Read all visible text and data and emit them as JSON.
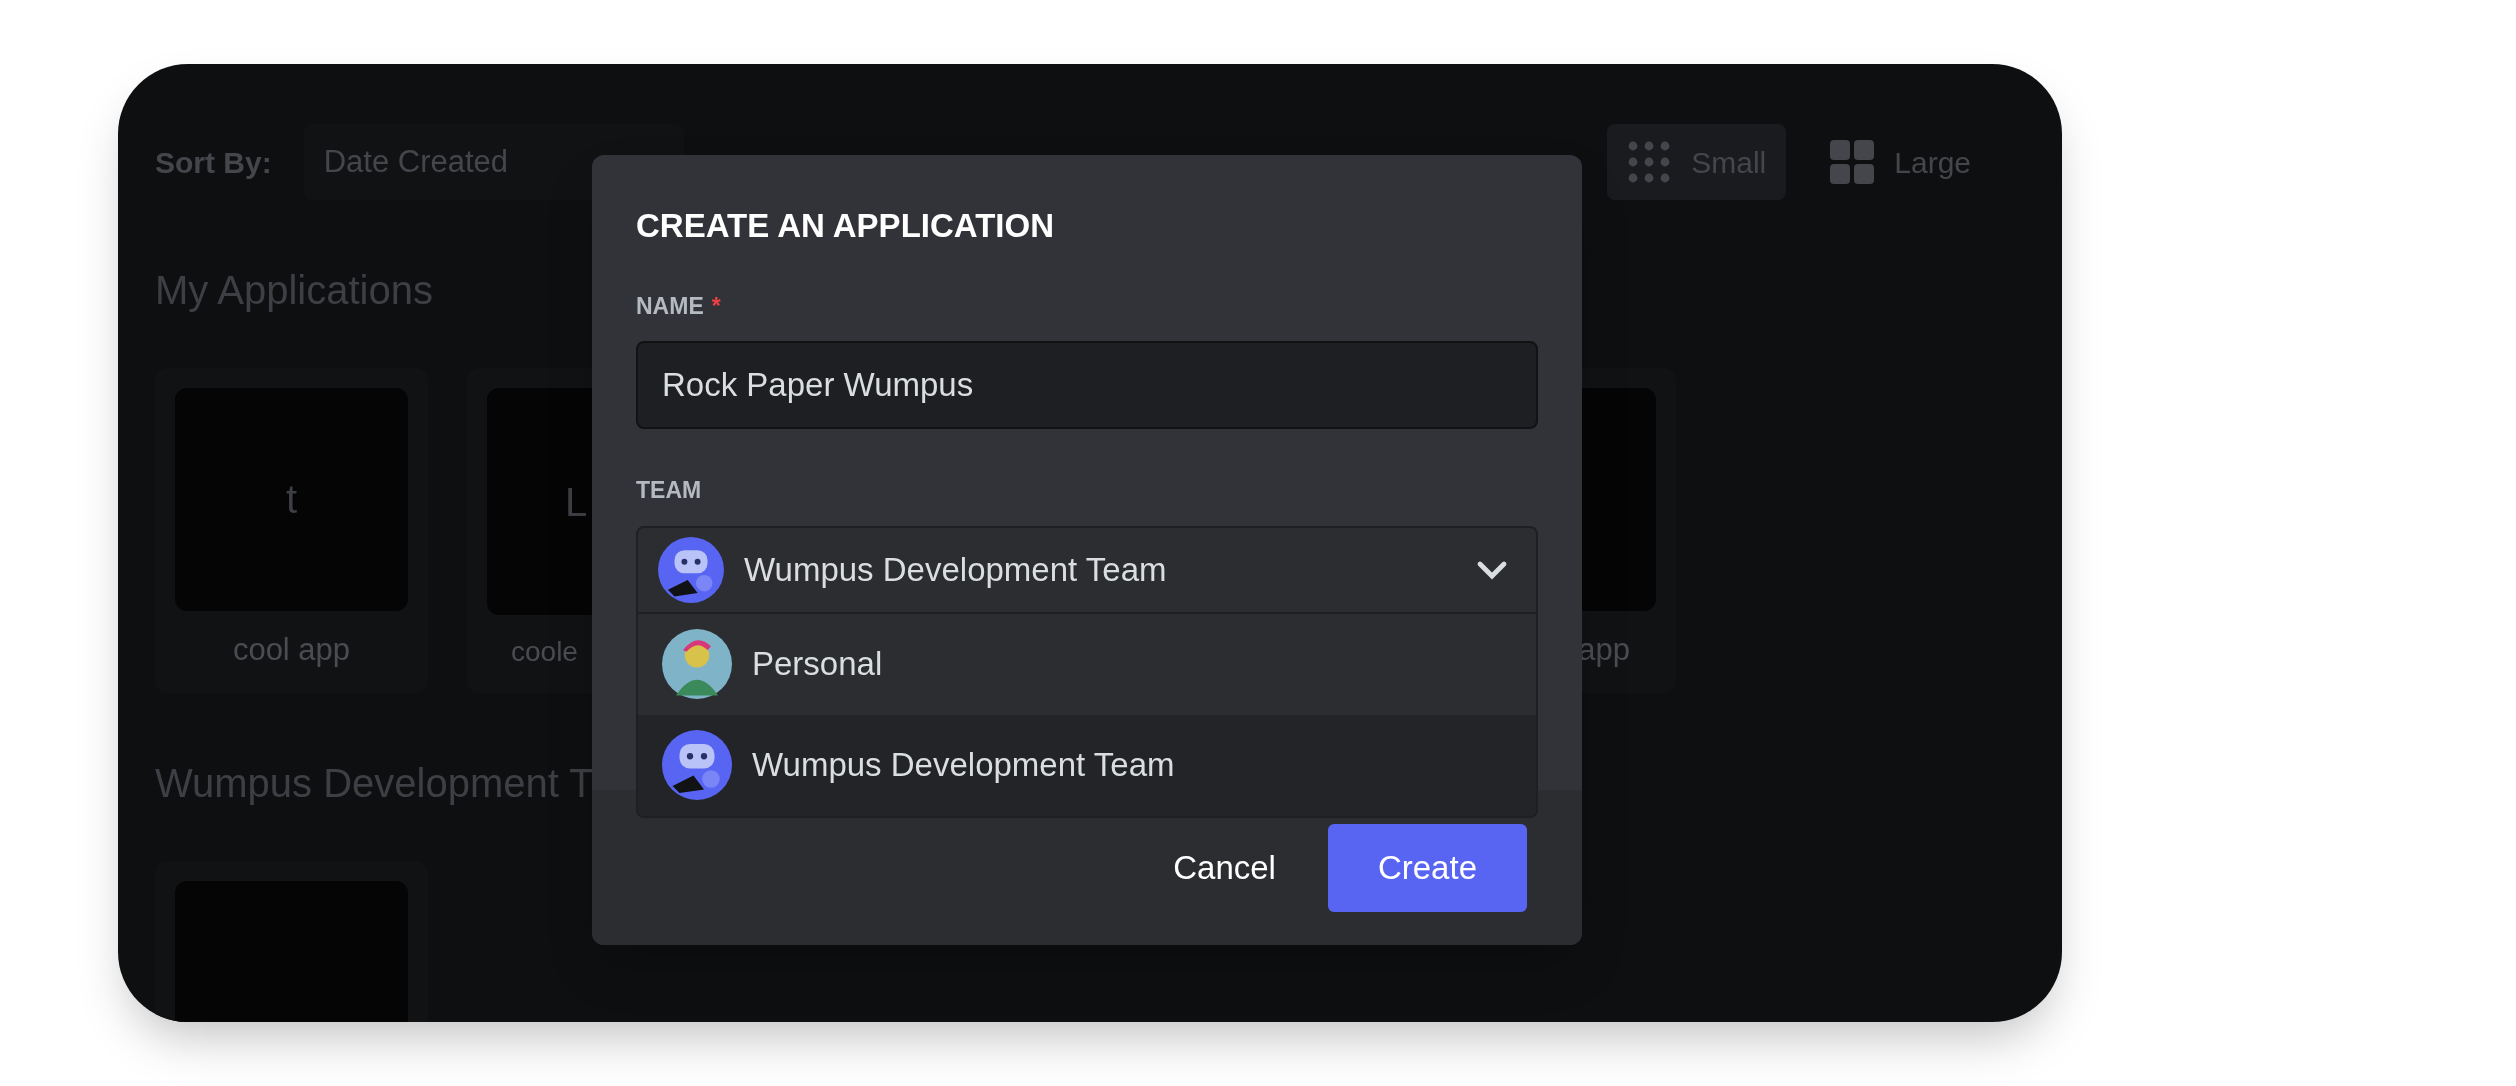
{
  "toolbar": {
    "sort_label": "Sort By:",
    "sort_value": "Date Created",
    "view_options": [
      {
        "label": "Small",
        "kind": "dots",
        "selected": true
      },
      {
        "label": "Large",
        "kind": "squares",
        "selected": false
      }
    ]
  },
  "sections": [
    {
      "title": "My Applications",
      "apps": [
        {
          "kind": "full",
          "icon_text": "t",
          "name": "cool app"
        },
        {
          "kind": "cut_right",
          "icon_text": "L",
          "name": "coole"
        },
        {
          "kind": "cut_left",
          "name": "app"
        }
      ]
    },
    {
      "title": "Wumpus Development T",
      "apps": [
        {
          "kind": "blank"
        }
      ]
    }
  ],
  "modal": {
    "title": "CREATE AN APPLICATION",
    "name_field": {
      "label": "NAME",
      "required": true,
      "required_mark": "*",
      "value": "Rock Paper Wumpus"
    },
    "team_field": {
      "label": "TEAM",
      "value": "Wumpus Development Team",
      "expanded": true,
      "options": [
        {
          "label": "Personal",
          "kind": "person",
          "selected": false
        },
        {
          "label": "Wumpus Development Team",
          "kind": "team",
          "selected": true
        }
      ]
    },
    "buttons": [
      {
        "label": "Cancel",
        "kind": "link"
      },
      {
        "label": "Create",
        "kind": "primary"
      }
    ]
  }
}
